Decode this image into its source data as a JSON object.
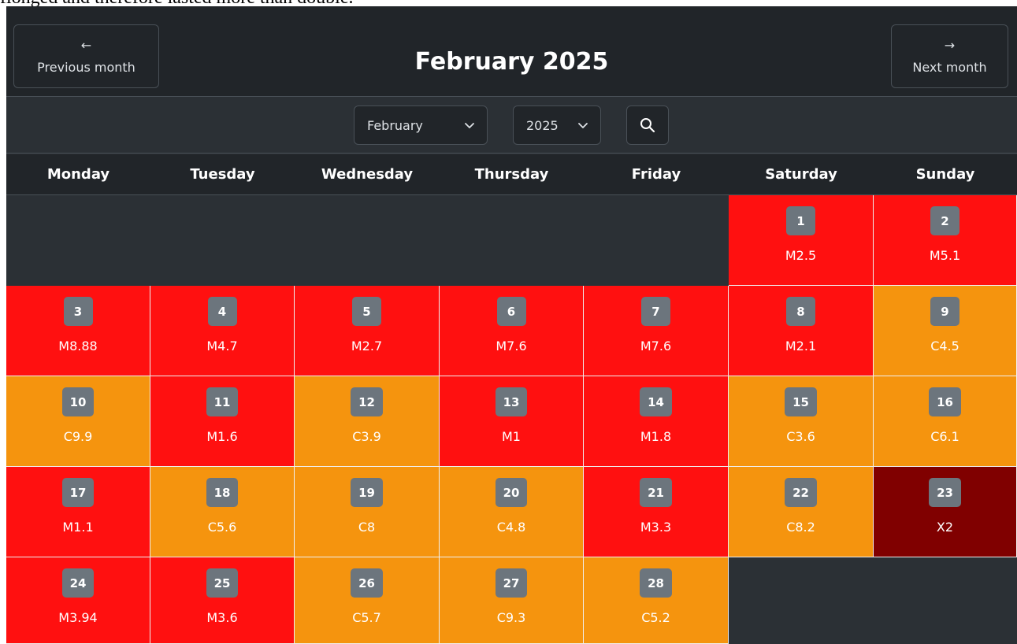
{
  "top_text": "flonged and therefore lasted more than double.",
  "header": {
    "prev_arrow": "←",
    "prev_label": "Previous month",
    "title": "February 2025",
    "next_arrow": "→",
    "next_label": "Next month"
  },
  "controls": {
    "month_value": "February",
    "year_value": "2025"
  },
  "weekdays": [
    "Monday",
    "Tuesday",
    "Wednesday",
    "Thursday",
    "Friday",
    "Saturday",
    "Sunday"
  ],
  "colors": {
    "M": "#ff1010",
    "C": "#f5940e",
    "X": "#800000",
    "M_alt": "#ff0000",
    "C_alt": "#f7a01e"
  },
  "days": [
    {
      "day": "1",
      "flare": "M2.5",
      "col": 6
    },
    {
      "day": "2",
      "flare": "M5.1"
    },
    {
      "day": "3",
      "flare": "M8.88"
    },
    {
      "day": "4",
      "flare": "M4.7"
    },
    {
      "day": "5",
      "flare": "M2.7"
    },
    {
      "day": "6",
      "flare": "M7.6"
    },
    {
      "day": "7",
      "flare": "M7.6"
    },
    {
      "day": "8",
      "flare": "M2.1"
    },
    {
      "day": "9",
      "flare": "C4.5"
    },
    {
      "day": "10",
      "flare": "C9.9"
    },
    {
      "day": "11",
      "flare": "M1.6"
    },
    {
      "day": "12",
      "flare": "C3.9"
    },
    {
      "day": "13",
      "flare": "M1"
    },
    {
      "day": "14",
      "flare": "M1.8"
    },
    {
      "day": "15",
      "flare": "C3.6"
    },
    {
      "day": "16",
      "flare": "C6.1"
    },
    {
      "day": "17",
      "flare": "M1.1"
    },
    {
      "day": "18",
      "flare": "C5.6"
    },
    {
      "day": "19",
      "flare": "C8"
    },
    {
      "day": "20",
      "flare": "C4.8"
    },
    {
      "day": "21",
      "flare": "M3.3"
    },
    {
      "day": "22",
      "flare": "C8.2"
    },
    {
      "day": "23",
      "flare": "X2"
    },
    {
      "day": "24",
      "flare": "M3.94"
    },
    {
      "day": "25",
      "flare": "M3.6"
    },
    {
      "day": "26",
      "flare": "C5.7"
    },
    {
      "day": "27",
      "flare": "C9.3"
    },
    {
      "day": "28",
      "flare": "C5.2"
    }
  ]
}
